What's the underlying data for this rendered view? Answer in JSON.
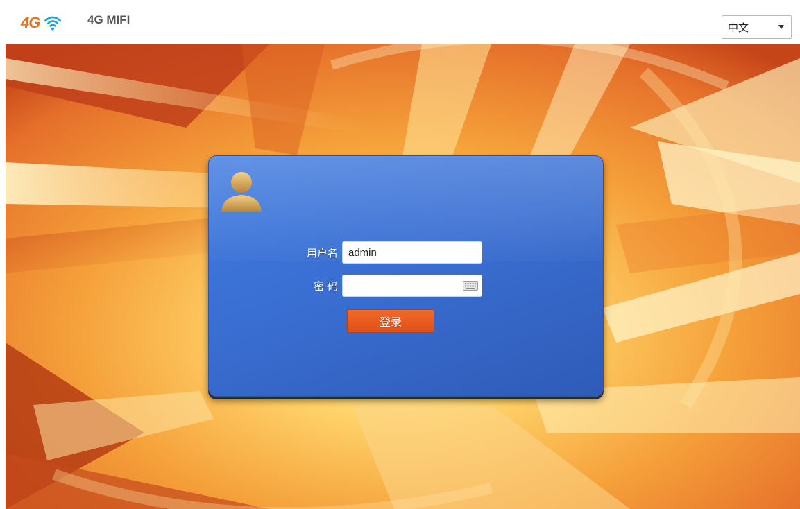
{
  "header": {
    "logo_text": "4G",
    "product_name": "4G MIFI",
    "language": {
      "selected": "中文"
    }
  },
  "login": {
    "username_label": "用户名",
    "username_value": "admin",
    "password_label": "密 码",
    "password_value": "",
    "submit_label": "登录"
  },
  "icons": {
    "logo_wifi": "wifi-icon",
    "avatar": "user-avatar-icon",
    "keyboard": "keyboard-icon",
    "dropdown": "chevron-down-icon"
  },
  "colors": {
    "card_blue": "#3a6fd2",
    "button_orange": "#e9561c",
    "logo_orange": "#e8711c"
  }
}
